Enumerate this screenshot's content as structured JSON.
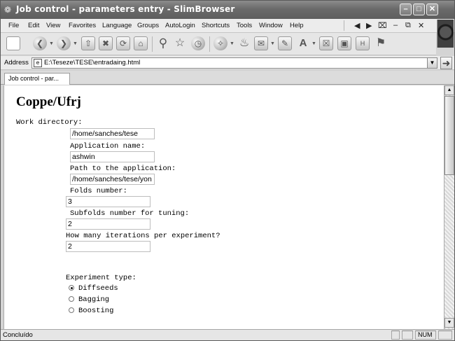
{
  "window": {
    "title": "Job control - parameters entry - SlimBrowser",
    "app_icon": "browser-globe-icon"
  },
  "menubar": {
    "items": [
      "File",
      "Edit",
      "View",
      "Favorites",
      "Language",
      "Groups",
      "AutoLogin",
      "Shortcuts",
      "Tools",
      "Window",
      "Help"
    ]
  },
  "address": {
    "label": "Address",
    "value": "E:\\Teseze\\TESE\\entradaing.html"
  },
  "tabs": [
    {
      "label": "Job control - par..."
    }
  ],
  "page": {
    "heading": "Coppe/Ufrj",
    "fields": [
      {
        "label": "Work directory:",
        "value": "/home/sanches/tese"
      },
      {
        "label": "Application name:",
        "value": "ashwin"
      },
      {
        "label": "Path to the application:",
        "value": "/home/sanches/tese/yon"
      },
      {
        "label": "Folds number:",
        "value": "3"
      },
      {
        "label": "Subfolds number for tuning:",
        "value": "2"
      },
      {
        "label": "How many iterations per experiment?",
        "value": "2"
      }
    ],
    "experiment_type": {
      "label": "Experiment type:",
      "options": [
        {
          "label": "Diffseeds",
          "checked": true
        },
        {
          "label": "Bagging",
          "checked": false
        },
        {
          "label": "Boosting",
          "checked": false
        }
      ]
    }
  },
  "statusbar": {
    "text": "Concluído",
    "num": "NUM"
  }
}
